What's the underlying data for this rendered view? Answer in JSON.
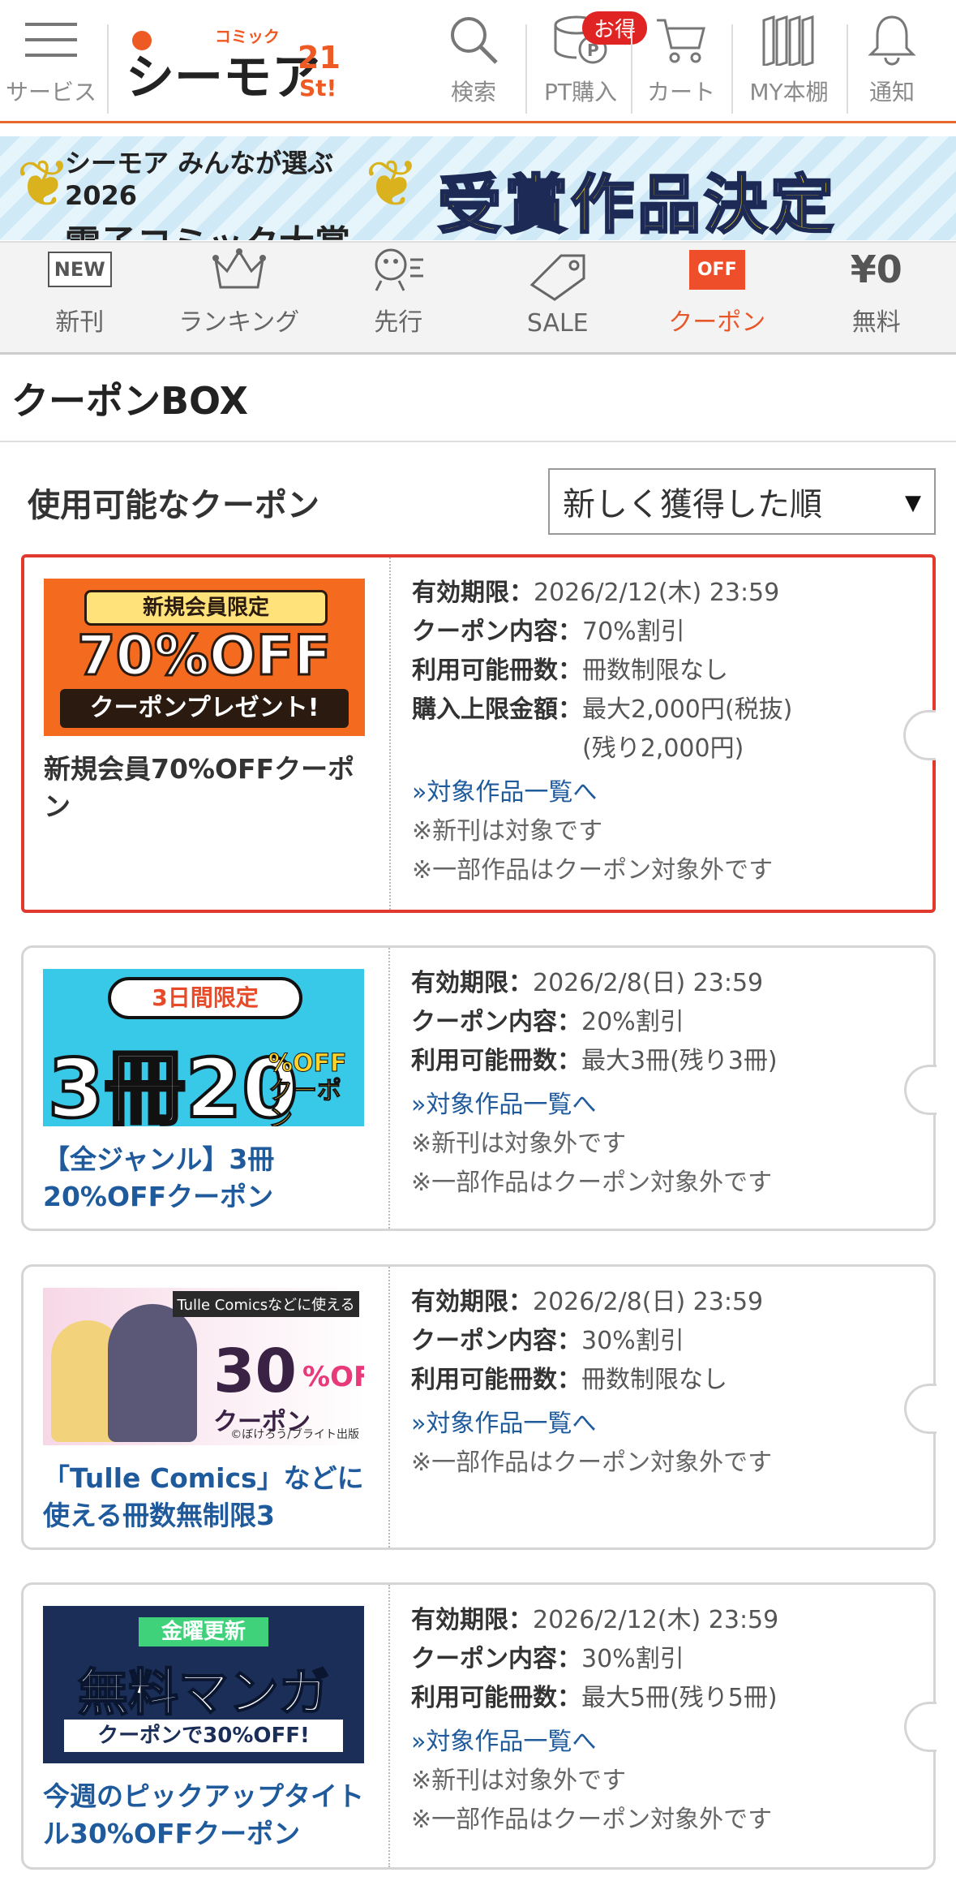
{
  "header": {
    "service_label": "サービス",
    "logo_top": "コミック",
    "logo_main": "シーモア",
    "logo_num": "21",
    "logo_st": "St!",
    "search_label": "検索",
    "pt_label": "PT購入",
    "pt_badge": "お得",
    "cart_label": "カート",
    "shelf_label": "MY本棚",
    "notify_label": "通知",
    "accent_color": "#e8692c"
  },
  "banner": {
    "line1": "シーモア みんなが選ぶ 2026",
    "line2": "電子コミック大賞",
    "headline": "受賞作品決定"
  },
  "catnav": {
    "new_icon": "NEW",
    "new_label": "新刊",
    "ranking_label": "ランキング",
    "preview_label": "先行",
    "sale_label": "SALE",
    "off_icon": "OFF",
    "coupon_label": "クーポン",
    "free_icon": "¥0",
    "free_label": "無料"
  },
  "page": {
    "title": "クーポンBOX",
    "subhead": "使用可能なクーポン",
    "sort_value": "新しく獲得した順",
    "sort_caret": "▼"
  },
  "coupons": [
    {
      "img_tag": "新規会員限定",
      "img_pct": "70%OFF",
      "img_sub": "クーポンプレゼント!",
      "name": "新規会員70%OFFクーポン",
      "expiry_label": "有効期限：",
      "expiry": "2026/2/12(木) 23:59",
      "content_label": "クーポン内容：",
      "content": "70%割引",
      "count_label": "利用可能冊数：",
      "count": "冊数制限なし",
      "limit_label": "購入上限金額：",
      "limit": "最大2,000円(税抜)",
      "limit_remain": "(残り2,000円)",
      "link": "»対象作品一覧へ",
      "note1": "※新刊は対象です",
      "note2": "※一部作品はクーポン対象外です"
    },
    {
      "img_tag": "3日間限定",
      "img_pct": "3冊20",
      "img_sub": "%OFFクーポン",
      "name": "【全ジャンル】3冊20%OFFクーポン",
      "expiry_label": "有効期限：",
      "expiry": "2026/2/8(日) 23:59",
      "content_label": "クーポン内容：",
      "content": "20%割引",
      "count_label": "利用可能冊数：",
      "count": "最大3冊(残り3冊)",
      "link": "»対象作品一覧へ",
      "note1": "※新刊は対象外です",
      "note2": "※一部作品はクーポン対象外です"
    },
    {
      "img_top": "Tulle Comicsなどに使える",
      "img_pct": "30",
      "img_off": "%OFF",
      "img_sub": "クーポン",
      "img_credit": "©ぼけろう/ブライト出版",
      "name": "「Tulle Comics」などに使える冊数無制限3",
      "expiry_label": "有効期限：",
      "expiry": "2026/2/8(日) 23:59",
      "content_label": "クーポン内容：",
      "content": "30%割引",
      "count_label": "利用可能冊数：",
      "count": "冊数制限なし",
      "link": "»対象作品一覧へ",
      "note1": "※一部作品はクーポン対象外です"
    },
    {
      "img_tag": "金曜更新",
      "img_pct": "無料マンガ",
      "img_sub": "クーポンで30%OFF!",
      "name": "今週のピックアップタイトル30%OFFクーポン",
      "expiry_label": "有効期限：",
      "expiry": "2026/2/12(木) 23:59",
      "content_label": "クーポン内容：",
      "content": "30%割引",
      "count_label": "利用可能冊数：",
      "count": "最大5冊(残り5冊)",
      "link": "»対象作品一覧へ",
      "note1": "※新刊は対象外です",
      "note2": "※一部作品はクーポン対象外です"
    }
  ]
}
